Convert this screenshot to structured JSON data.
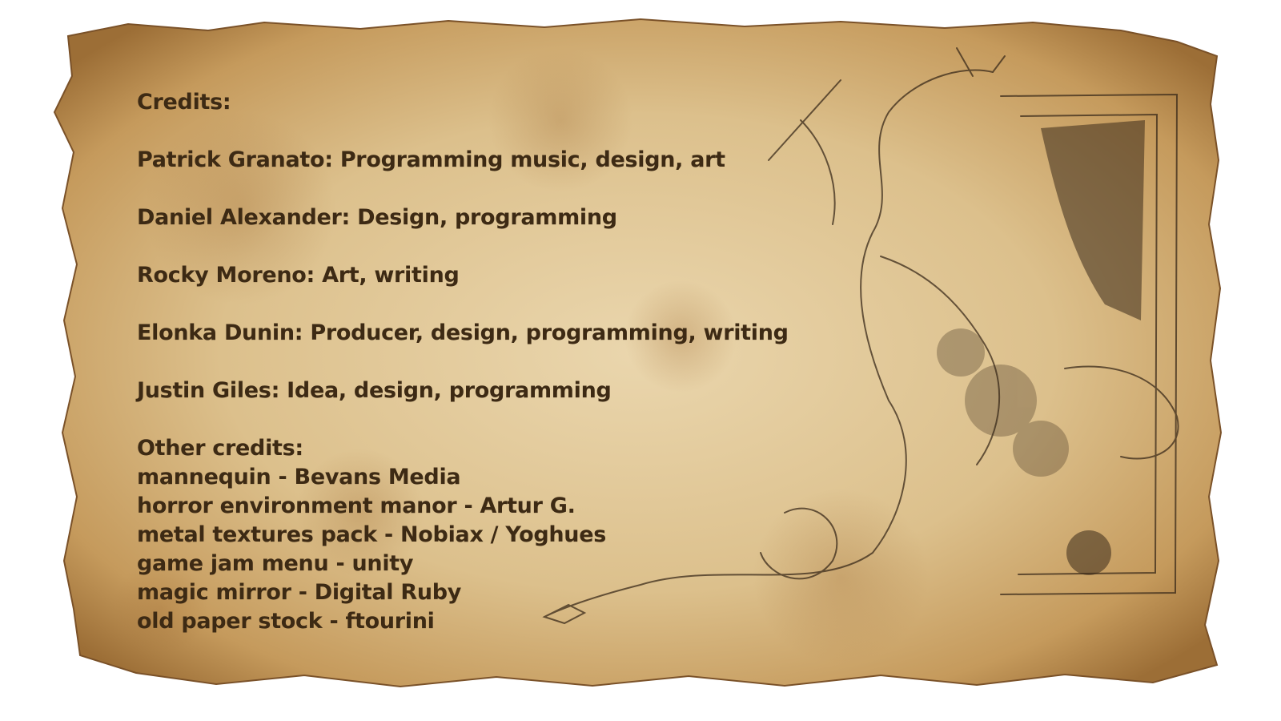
{
  "credits": {
    "heading": "Credits:",
    "team": [
      "Patrick Granato: Programming music, design, art",
      "Daniel Alexander: Design, programming",
      "Rocky Moreno: Art, writing",
      "Elonka Dunin: Producer, design, programming, writing",
      "Justin Giles: Idea, design, programming"
    ],
    "other_heading": "Other credits:",
    "other": [
      "mannequin - Bevans Media",
      "horror environment manor - Artur G.",
      "metal textures pack - Nobiax / Yoghues",
      "game jam menu - unity",
      "magic mirror - Digital Ruby",
      "old paper stock - ftourini"
    ]
  },
  "colors": {
    "text": "#3d2a14",
    "parchment_center": "#e8d3a8",
    "parchment_edge": "#a87a40",
    "ink": "#3a2a1a"
  },
  "icons": {
    "illustration": "mirror-and-creature-sketch-icon"
  }
}
